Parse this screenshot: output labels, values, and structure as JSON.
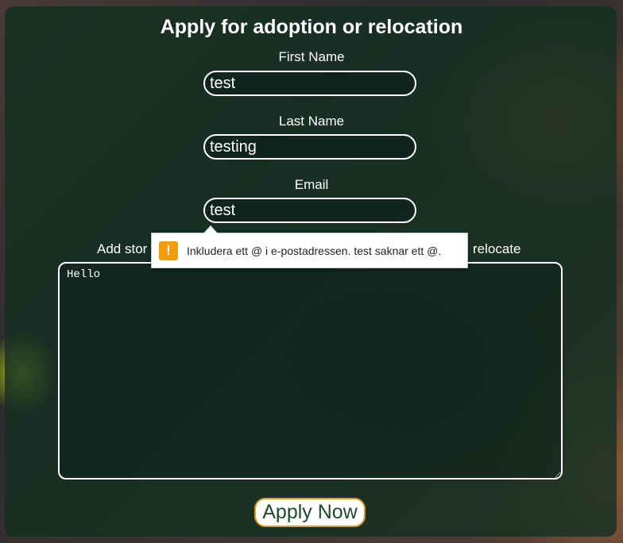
{
  "form": {
    "title": "Apply for adoption or relocation",
    "first_name_label": "First Name",
    "first_name_value": "test",
    "last_name_label": "Last Name",
    "last_name_value": "testing",
    "email_label": "Email",
    "email_value": "test",
    "story_label_start": "Add stor",
    "story_label_end": "relocate",
    "story_value": "Hello",
    "apply_button_label": "Apply Now"
  },
  "validation_tooltip": {
    "icon": "warning-icon",
    "icon_glyph": "!",
    "message": "Inkludera ett @ i e-postadressen. test saknar ett @."
  },
  "colors": {
    "panel": "#12301f",
    "button_border": "#d89a2a",
    "button_text": "#1f4a2a",
    "warning": "#f29d0c"
  }
}
